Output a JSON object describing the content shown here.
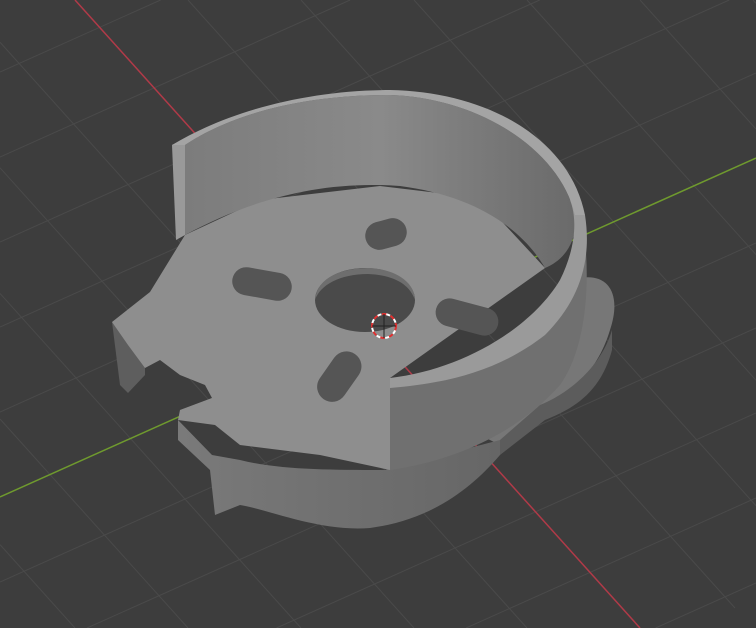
{
  "viewport": {
    "mode": "3d-viewport",
    "colors": {
      "background": "#3d3d3d",
      "grid": "#4a4a4a",
      "x_axis": "#b03a48",
      "y_axis": "#6f9a2e",
      "model_top": "#8f8f8f",
      "model_side": "#6b6b6b",
      "model_dark": "#575757",
      "cursor_red": "#e03030"
    }
  }
}
